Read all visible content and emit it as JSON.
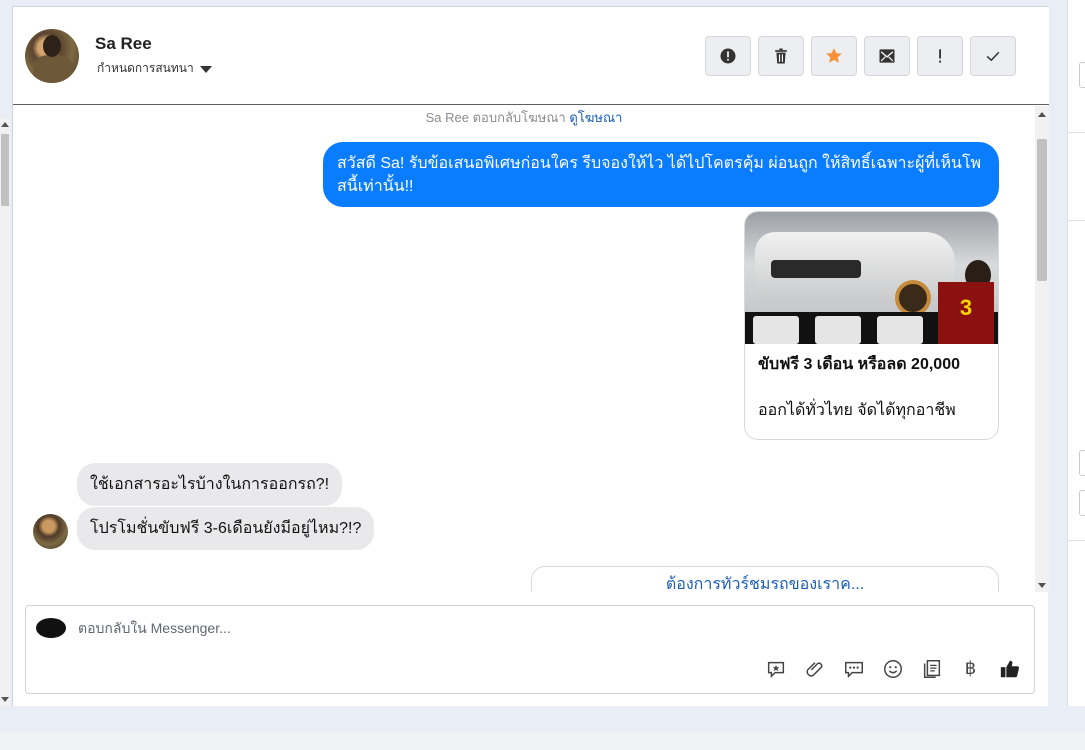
{
  "header": {
    "contact_name": "Sa Ree",
    "assign_label": "กำหนดการสนทนา",
    "actions": [
      {
        "icon": "alert-circle-icon"
      },
      {
        "icon": "trash-icon"
      },
      {
        "icon": "star-icon"
      },
      {
        "icon": "mark-unread-envelope-icon"
      },
      {
        "icon": "exclamation-icon"
      },
      {
        "icon": "check-icon"
      }
    ]
  },
  "conversation": {
    "reply_note_prefix": "Sa Ree ตอบกลับโฆษณา",
    "reply_note_link": "ดูโฆษณา",
    "outgoing_message": "สวัสดี Sa! รับข้อเสนอพิเศษก่อนใคร รีบจองให้ไว ได้ไปโคตรคุ้ม ผ่อนถูก ให้สิทธิ์เฉพาะผู้ที่เห็นโพสนี้เท่านั้น!!",
    "ad_card": {
      "headline": "ขับฟรี 3 เดือน หรือลด 20,000",
      "body": "ออกได้ทั่วไทย จัดได้ทุกอาชีพ",
      "image_badge": "3"
    },
    "incoming_messages": [
      "ใช้เอกสารอะไรบ้างในการออกรถ?!",
      "โปรโมชั่นขับฟรี 3-6เดือนยังมีอยู่ไหม?!?"
    ],
    "cta_button": "ต้องการทัวร์ชมรถของเราค..."
  },
  "composer": {
    "placeholder": "ตอบกลับใน Messenger...",
    "baht_symbol": "฿",
    "tools": [
      "saved-reply-icon",
      "attachment-icon",
      "chat-bubbles-icon",
      "emoji-icon",
      "notes-icon",
      "baht-icon",
      "thumbs-up-icon"
    ]
  },
  "colors": {
    "outgoing_bubble": "#0a7cff",
    "incoming_bubble": "#e9e9eb",
    "star_accent": "#f7923a",
    "link": "#1b5fb5"
  }
}
